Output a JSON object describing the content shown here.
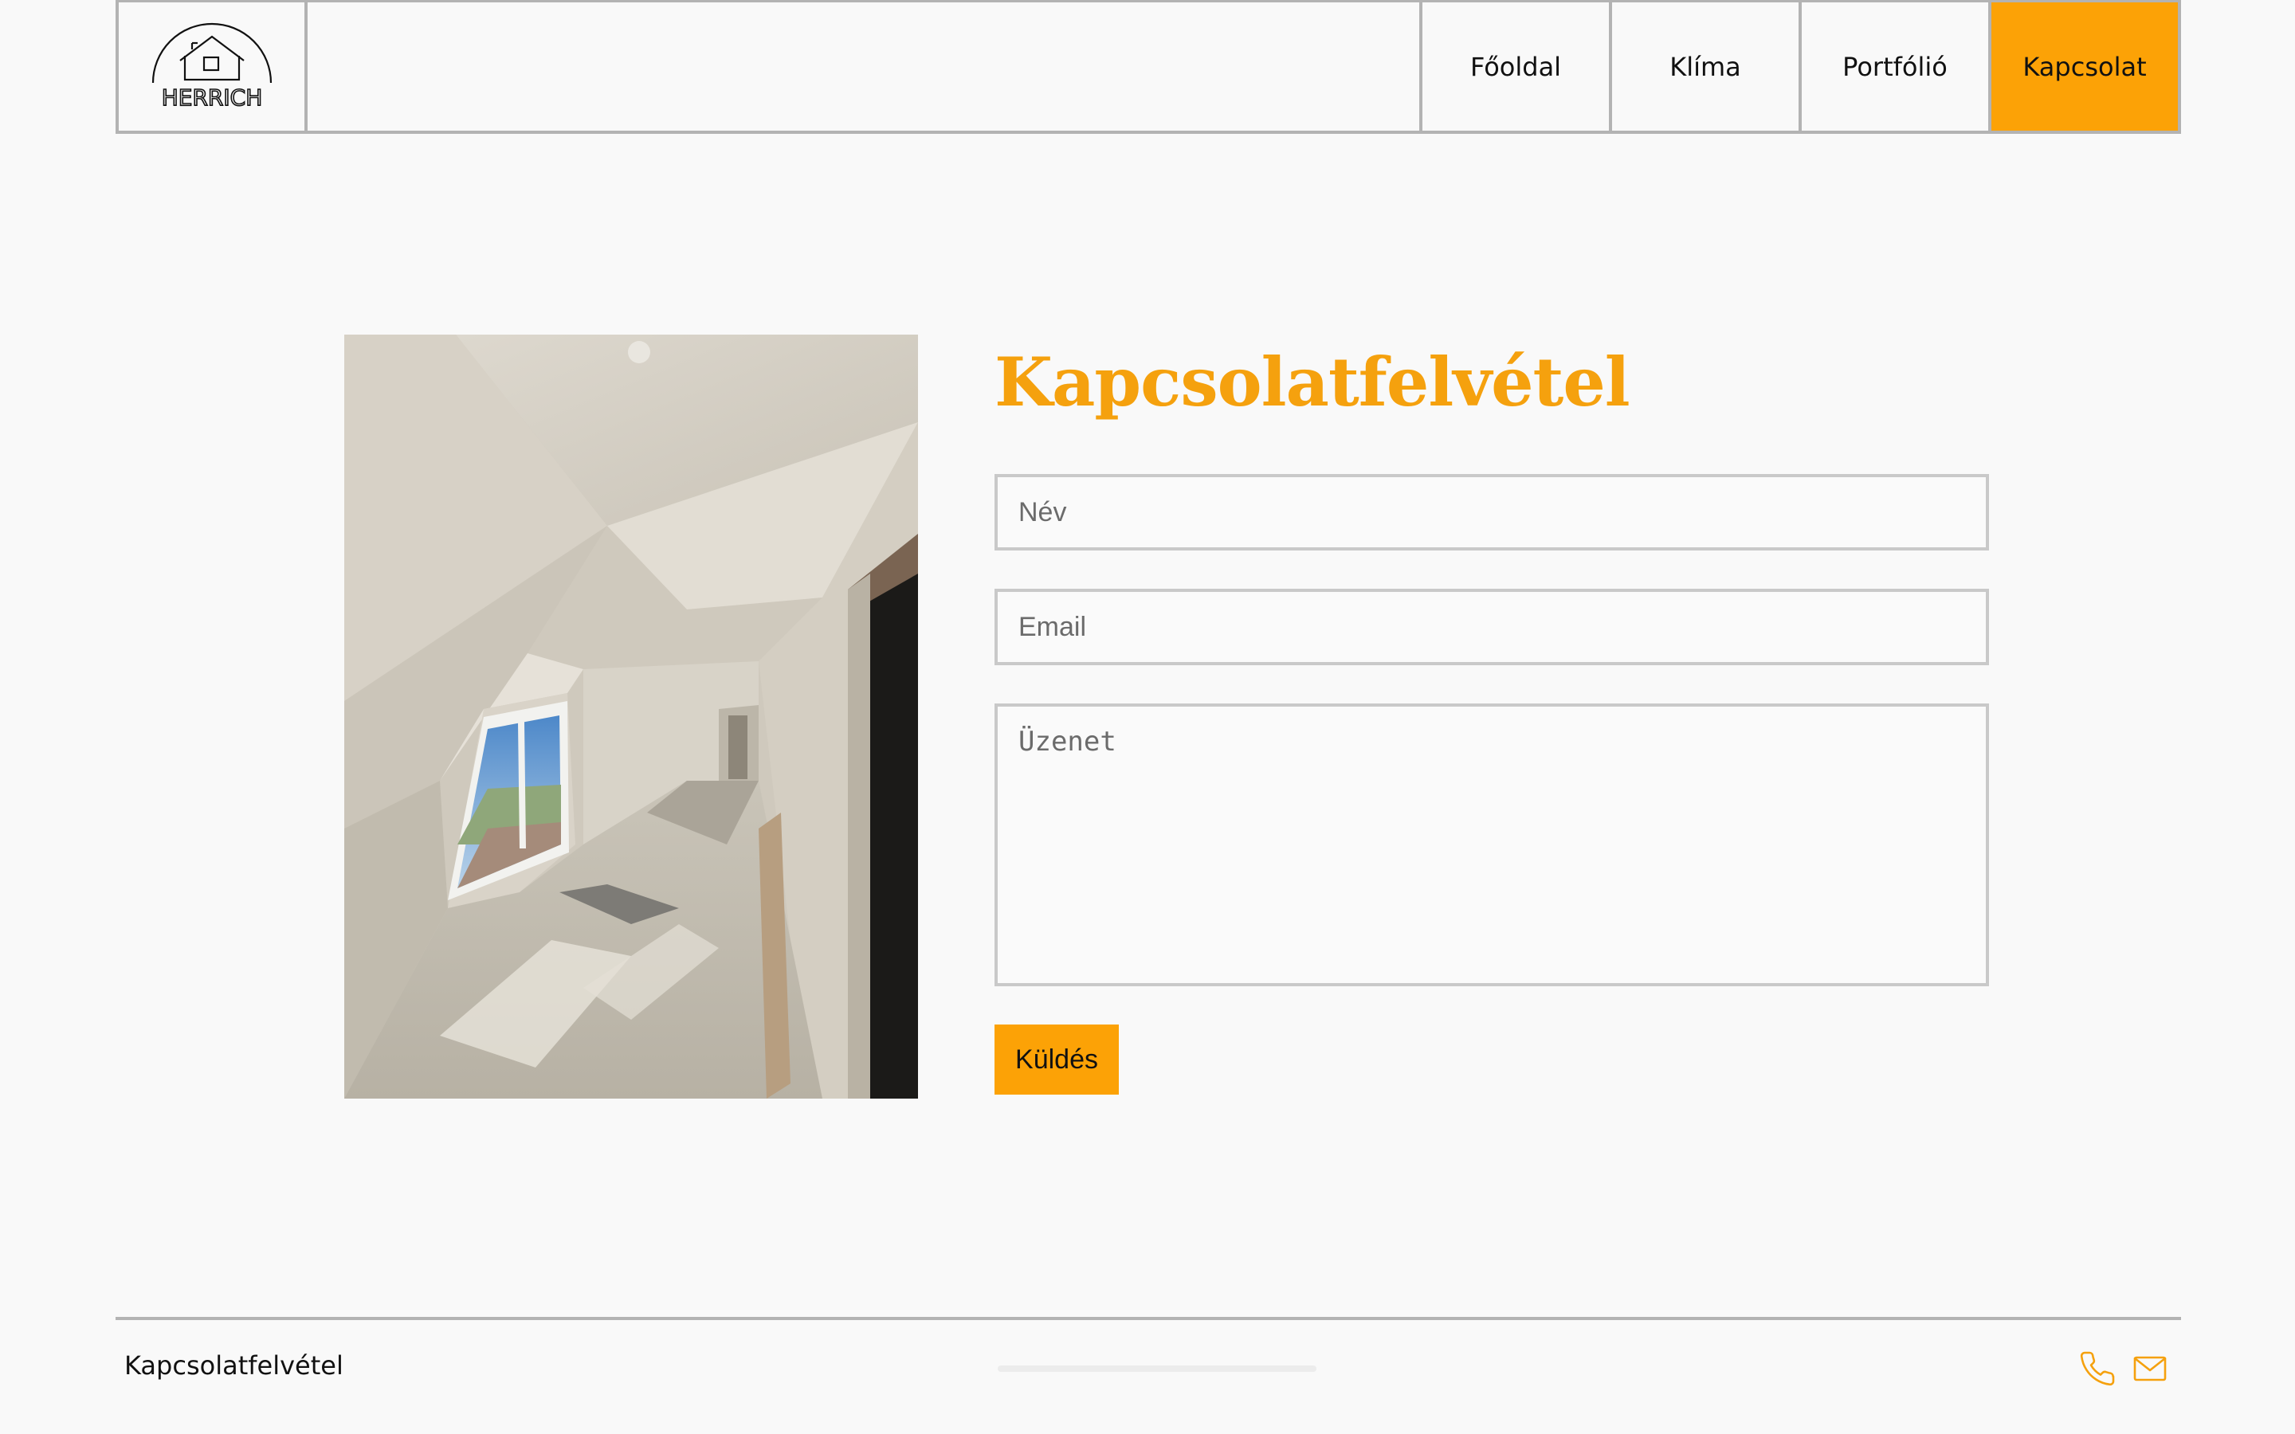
{
  "brand": {
    "logo_text": "HERRICH"
  },
  "nav": {
    "items": [
      {
        "label": "Főoldal"
      },
      {
        "label": "Klíma"
      },
      {
        "label": "Portfólió"
      },
      {
        "label": "Kapcsolat",
        "active": true
      }
    ]
  },
  "contact_form": {
    "title": "Kapcsolatfelvétel",
    "name_placeholder": "Név",
    "email_placeholder": "Email",
    "message_placeholder": "Üzenet",
    "submit_label": "Küldés"
  },
  "footer": {
    "label": "Kapcsolatfelvétel",
    "icons": [
      "phone-icon",
      "mail-icon"
    ]
  },
  "colors": {
    "accent": "#fca206",
    "title": "#f5a10e",
    "border": "#b3b3b3",
    "background": "#f9f9f9"
  }
}
